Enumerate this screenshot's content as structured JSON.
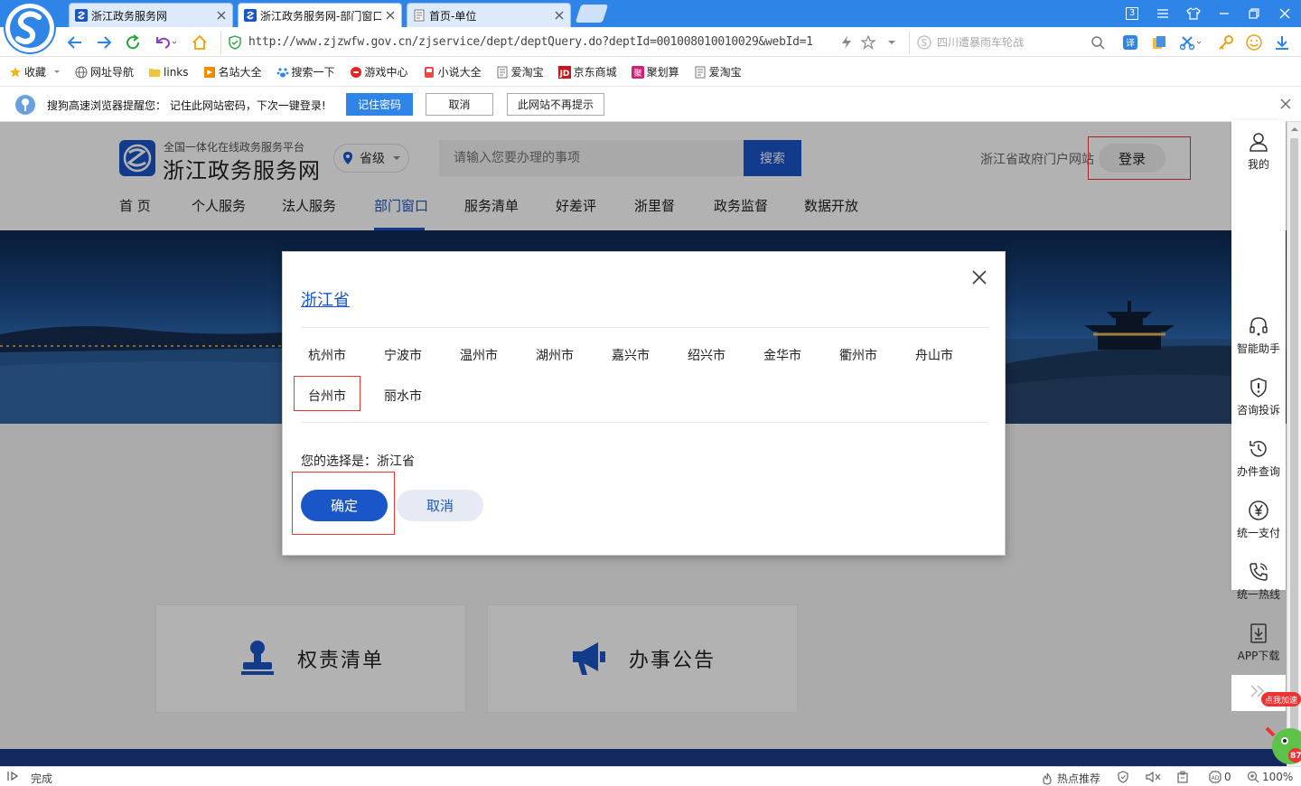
{
  "browser": {
    "tabs": [
      {
        "label": "浙江政务服务网",
        "active": false
      },
      {
        "label": "浙江政务服务网-部门窗口",
        "active": true
      },
      {
        "label": "首页-单位",
        "active": false
      }
    ],
    "window_badge": "3",
    "url": "http://www.zjzwfw.gov.cn/zjservice/dept/deptQuery.do?deptId=001008010010029&webId=1",
    "search_placeholder": "四川遭暴雨车轮战",
    "bookmarks": [
      {
        "label": "收藏",
        "icon": "star-icon"
      },
      {
        "label": "网址导航",
        "icon": "globe-icon"
      },
      {
        "label": "links",
        "icon": "folder-icon"
      },
      {
        "label": "名站大全",
        "icon": "bookmark-icon"
      },
      {
        "label": "搜索一下",
        "icon": "paw-icon"
      },
      {
        "label": "游戏中心",
        "icon": "game-icon"
      },
      {
        "label": "小说大全",
        "icon": "book-icon"
      },
      {
        "label": "爱淘宝",
        "icon": "page-icon"
      },
      {
        "label": "京东商城",
        "icon": "jd-icon"
      },
      {
        "label": "聚划算",
        "icon": "juhuasuan-icon"
      },
      {
        "label": "爱淘宝",
        "icon": "page-icon"
      }
    ],
    "password_bar": {
      "message": "搜狗高速浏览器提醒您： 记住此网站密码，下次一键登录!",
      "remember": "记住密码",
      "cancel": "取消",
      "never": "此网站不再提示"
    },
    "status": {
      "left": "完成",
      "hot": "热点推荐",
      "count": "0",
      "zoom": "100%"
    }
  },
  "site": {
    "subtitle": "全国一体化在线政务服务平台",
    "title": "浙江政务服务网",
    "level": "省级",
    "search_placeholder": "请输入您要办理的事项",
    "search_button": "搜索",
    "portal_link": "浙江省政府门户网站",
    "login": "登录",
    "nav": [
      "首 页",
      "个人服务",
      "法人服务",
      "部门窗口",
      "服务清单",
      "好差评",
      "浙里督",
      "政务监督",
      "数据开放"
    ],
    "cards": [
      "权责清单",
      "办事公告"
    ]
  },
  "sidebar": [
    {
      "label": "我的",
      "icon": "user-icon"
    },
    {
      "label": "智能助手",
      "icon": "headset-icon"
    },
    {
      "label": "咨询投诉",
      "icon": "alert-shield-icon"
    },
    {
      "label": "办件查询",
      "icon": "history-icon"
    },
    {
      "label": "统一支付",
      "icon": "yuan-icon"
    },
    {
      "label": "统一热线",
      "icon": "phone-icon"
    },
    {
      "label": "APP下载",
      "icon": "download-icon"
    }
  ],
  "mascot": {
    "badge": "点我加速",
    "value": "87"
  },
  "modal": {
    "province": "浙江省",
    "cities": [
      "杭州市",
      "宁波市",
      "温州市",
      "湖州市",
      "嘉兴市",
      "绍兴市",
      "金华市",
      "衢州市",
      "舟山市",
      "台州市",
      "丽水市"
    ],
    "selection_label": "您的选择是：浙江省",
    "confirm": "确定",
    "cancel": "取消"
  },
  "colors": {
    "browser_blue": "#2f84e8",
    "site_blue": "#1b56c8",
    "highlight_red": "#e33"
  }
}
